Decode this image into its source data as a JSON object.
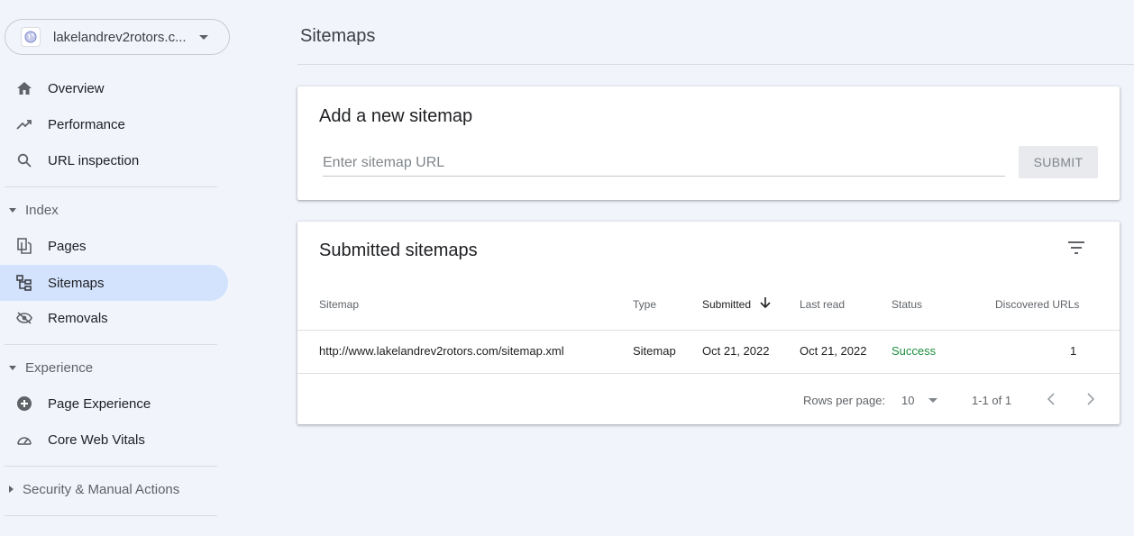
{
  "property": {
    "name": "lakelandrev2rotors.c...",
    "icon": "globe-icon"
  },
  "nav": {
    "overview": "Overview",
    "performance": "Performance",
    "url_inspection": "URL inspection",
    "index_section": "Index",
    "pages": "Pages",
    "sitemaps": "Sitemaps",
    "removals": "Removals",
    "experience_section": "Experience",
    "page_experience": "Page Experience",
    "core_web_vitals": "Core Web Vitals",
    "security_section": "Security & Manual Actions"
  },
  "page": {
    "title": "Sitemaps"
  },
  "add_sitemap": {
    "title": "Add a new sitemap",
    "placeholder": "Enter sitemap URL",
    "submit_label": "SUBMIT"
  },
  "submitted": {
    "title": "Submitted sitemaps",
    "columns": {
      "sitemap": "Sitemap",
      "type": "Type",
      "submitted": "Submitted",
      "last_read": "Last read",
      "status": "Status",
      "discovered": "Discovered URLs"
    },
    "rows": [
      {
        "sitemap": "http://www.lakelandrev2rotors.com/sitemap.xml",
        "type": "Sitemap",
        "submitted": "Oct 21, 2022",
        "last_read": "Oct 21, 2022",
        "status": "Success",
        "discovered": "1"
      }
    ],
    "footer": {
      "rows_per_page_label": "Rows per page:",
      "rows_per_page_value": "10",
      "range": "1-1 of 1"
    }
  },
  "colors": {
    "active_nav": "#d3e3fd",
    "success": "#1e8e3e",
    "background": "#f1f4fb"
  }
}
